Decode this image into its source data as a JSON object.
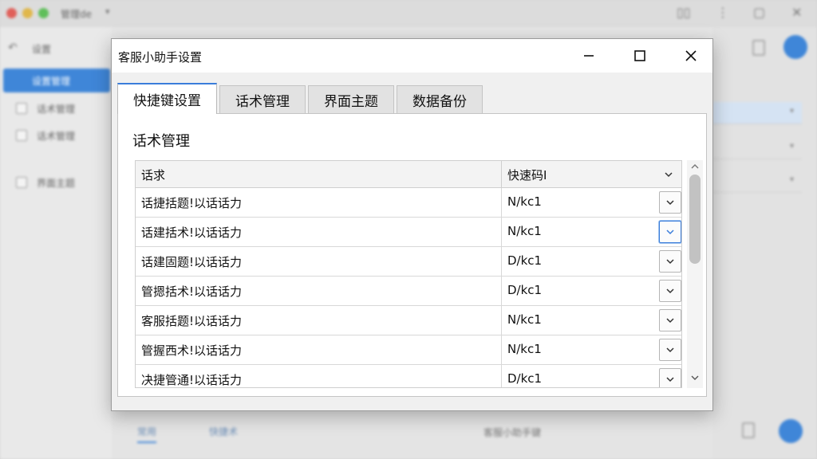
{
  "background": {
    "app_title": "管理de",
    "sidebar_header": "设置",
    "sidebar_active": "设置管理",
    "sidebar_items": [
      "话术管理",
      "话术管理",
      "界面主题"
    ],
    "right_fields": [
      "",
      "",
      "",
      ""
    ],
    "bottom_tabs": [
      "常用",
      "快捷术"
    ],
    "bottom_status": "客服小助手键"
  },
  "dialog": {
    "title": "客服小助手设置",
    "tabs": [
      {
        "label": "快捷键设置",
        "active": true
      },
      {
        "label": "话术管理",
        "active": false
      },
      {
        "label": "界面主题",
        "active": false
      },
      {
        "label": "数据备份",
        "active": false
      }
    ],
    "section_title": "话术管理",
    "table": {
      "headers": [
        "话求",
        "快速码I"
      ],
      "rows": [
        {
          "script": "话捷括题!以话话力",
          "code": "N/kc1"
        },
        {
          "script": "话建括术!以话话力",
          "code": "N/kc1"
        },
        {
          "script": "话建固题!以话话力",
          "code": "D/kc1"
        },
        {
          "script": "管摁括术!以话话力",
          "code": "D/kc1"
        },
        {
          "script": "客服括题!以话话力",
          "code": "N/kc1"
        },
        {
          "script": "管握西术!以话话力",
          "code": "N/kc1"
        },
        {
          "script": "决捷管通!以话话力",
          "code": "D/kc1"
        }
      ]
    }
  },
  "colors": {
    "accent": "#3a7ddb",
    "bg_accent": "#3f86d8"
  },
  "icons": {
    "minimize": "minimize-icon",
    "maximize": "maximize-icon",
    "close": "close-icon",
    "dropdown": "chevron-down-icon",
    "scroll_up": "chevron-up-icon",
    "scroll_down": "chevron-down-icon"
  }
}
